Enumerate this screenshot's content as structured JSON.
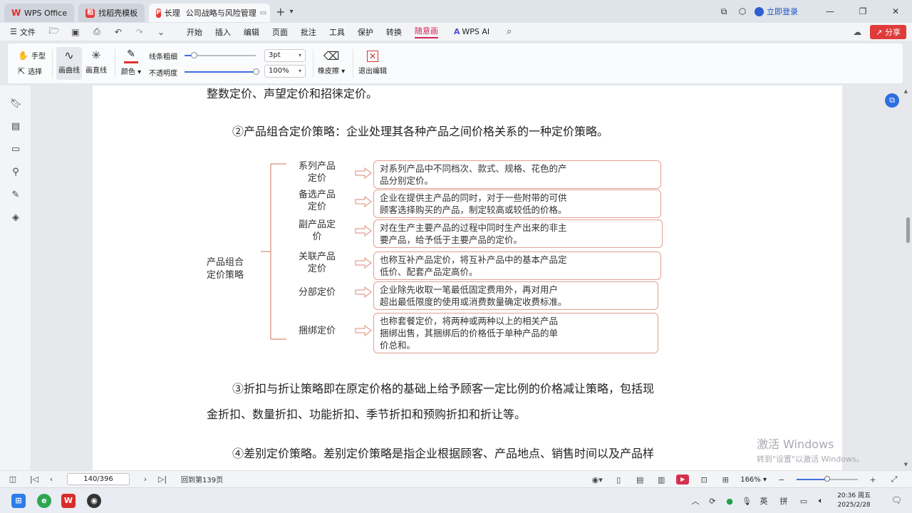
{
  "tabs": {
    "wps_office": "WPS Office",
    "template": "找稻壳模板",
    "doc_prefix": "长理",
    "doc_title": "公司战略与风险管理"
  },
  "title_right": {
    "login": "立即登录"
  },
  "menu": {
    "file": "文件",
    "items": [
      "开始",
      "插入",
      "编辑",
      "页面",
      "批注",
      "工具",
      "保护",
      "转换",
      "随意画"
    ],
    "wps_ai": "WPS AI",
    "share": "分享"
  },
  "toolbar": {
    "hand": "手型",
    "select": "选择",
    "curve": "画曲线",
    "line": "画直线",
    "color": "颜色",
    "line_width": "线条粗细",
    "opacity": "不透明度",
    "width_value": "3pt",
    "opacity_value": "100%",
    "eraser": "橡皮擦",
    "exit": "退出编辑",
    "colors": {
      "pen": "#e03030",
      "accent": "#d4235a"
    },
    "line_width_level": 0.13,
    "opacity_level": 1.0
  },
  "document": {
    "line_top": "整数定价、声望定价和招徕定价。",
    "para2": "②产品组合定价策略：企业处理其各种产品之间价格关系的一种定价策略。",
    "para3_line1": "③折扣与折让策略即在原定价格的基础上给予顾客一定比例的价格减让策略，包括现",
    "para3_line2": "金折扣、数量折扣、功能折扣、季节折扣和预购折扣和折让等。",
    "para4_line1": "④差别定价策略。差别定价策略是指企业根据顾客、产品地点、销售时间以及产品样",
    "diagram": {
      "root_line1": "产品组合",
      "root_line2": "定价策略",
      "items": [
        {
          "label1": "系列产品",
          "label2": "定价",
          "desc1": "对系列产品中不同档次、款式、规格、花色的产",
          "desc2": "品分别定价。",
          "desc3": ""
        },
        {
          "label1": "备选产品",
          "label2": "定价",
          "desc1": "企业在提供主产品的同时，对于一些附带的可供",
          "desc2": "顾客选择购买的产品，制定较高或较低的价格。",
          "desc3": ""
        },
        {
          "label1": "副产品定",
          "label2": "价",
          "desc1": "对在生产主要产品的过程中同时生产出来的非主",
          "desc2": "要产品，给予低于主要产品的定价。",
          "desc3": ""
        },
        {
          "label1": "关联产品",
          "label2": "定价",
          "desc1": "也称互补产品定价，将互补产品中的基本产品定",
          "desc2": "低价、配套产品定高价。",
          "desc3": ""
        },
        {
          "label1": "分部定价",
          "label2": "",
          "desc1": "企业除先收取一笔最低固定费用外，再对用户",
          "desc2": "超出最低限度的使用或消费数量确定收费标准。",
          "desc3": ""
        },
        {
          "label1": "捆绑定价",
          "label2": "",
          "desc1": "也称套餐定价，将两种或两种以上的相关产品",
          "desc2": "捆绑出售，其捆绑后的价格低于单种产品的单",
          "desc3": "价总和。"
        }
      ]
    }
  },
  "watermark": {
    "line1": "激活 Windows",
    "line2": "转到\"设置\"以激活 Windows。"
  },
  "status": {
    "page": "140/396",
    "back_to": "回到第139页",
    "zoom": "166%",
    "zoom_level": 0.5
  },
  "taskbar": {
    "ime1": "英",
    "ime2": "拼",
    "time": "20:36 周五",
    "date": "2025/2/28"
  }
}
